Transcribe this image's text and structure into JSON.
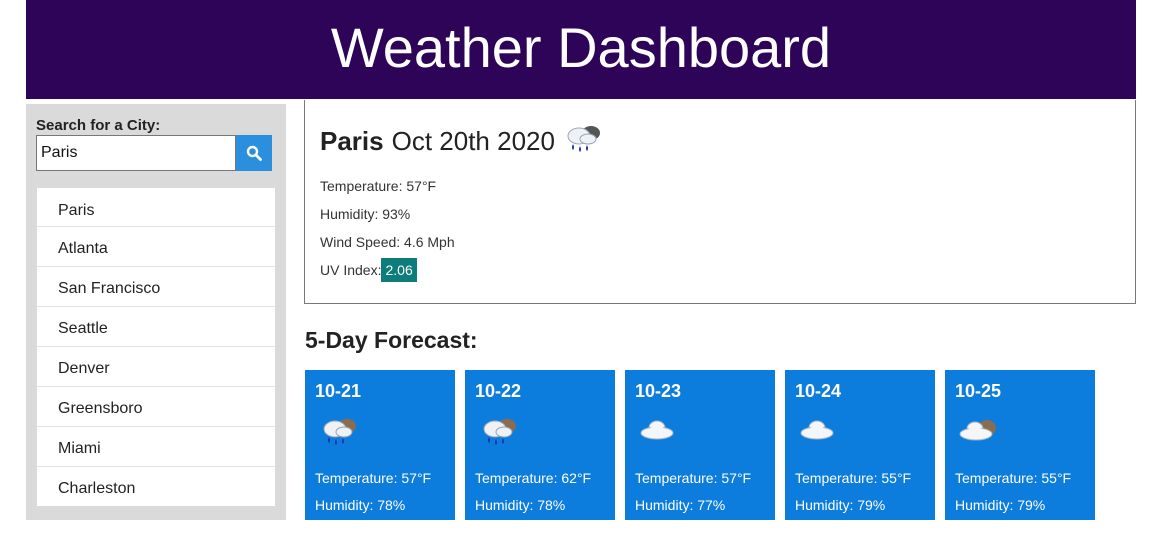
{
  "header": {
    "title": "Weather Dashboard"
  },
  "search": {
    "label": "Search for a City:",
    "value": "Paris",
    "icon": "search-icon"
  },
  "cities": [
    "Paris",
    "Atlanta",
    "San Francisco",
    "Seattle",
    "Denver",
    "Greensboro",
    "Miami",
    "Charleston"
  ],
  "current": {
    "city": "Paris",
    "date": "Oct 20th 2020",
    "icon": "rain-cloud-icon",
    "temperature": "Temperature: 57°F",
    "humidity": "Humidity: 93%",
    "wind": "Wind Speed: 4.6 Mph",
    "uv_label": "UV Index:",
    "uv_value": "2.06",
    "uv_color": "#0e7c7b"
  },
  "forecast": {
    "title": "5-Day Forecast:",
    "days": [
      {
        "date": "10-21",
        "icon": "rain-cloud-icon",
        "temp": "Temperature: 57°F",
        "humidity": "Humidity: 78%"
      },
      {
        "date": "10-22",
        "icon": "rain-cloud-icon",
        "temp": "Temperature: 62°F",
        "humidity": "Humidity: 78%"
      },
      {
        "date": "10-23",
        "icon": "cloud-icon",
        "temp": "Temperature: 57°F",
        "humidity": "Humidity: 77%"
      },
      {
        "date": "10-24",
        "icon": "cloud-icon",
        "temp": "Temperature: 55°F",
        "humidity": "Humidity: 79%"
      },
      {
        "date": "10-25",
        "icon": "broken-clouds-icon",
        "temp": "Temperature: 55°F",
        "humidity": "Humidity: 79%"
      }
    ]
  },
  "colors": {
    "header_bg": "#2e0459",
    "card_bg": "#0c7ddc",
    "search_btn": "#2b8fe0"
  }
}
